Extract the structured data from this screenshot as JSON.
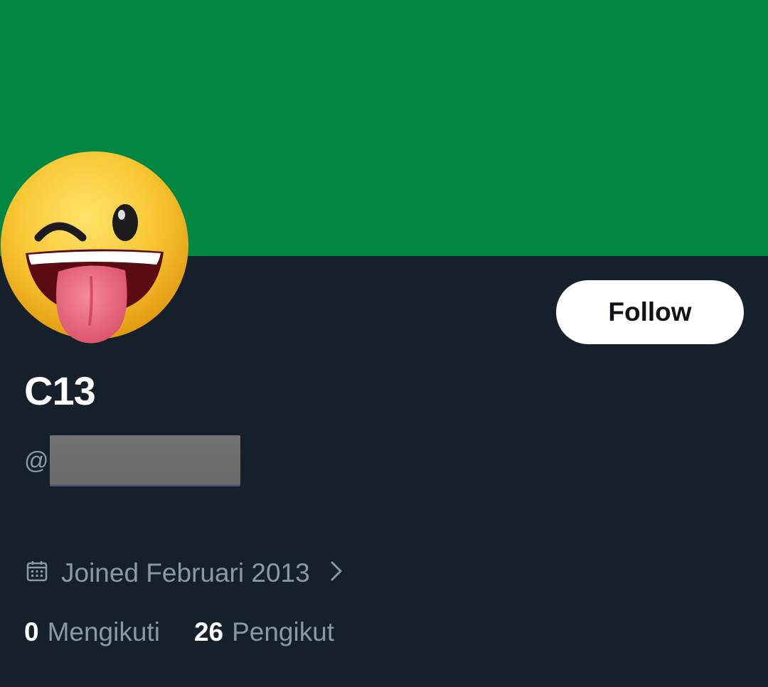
{
  "profile": {
    "display_name": "C13",
    "handle_prefix": "@",
    "follow_label": "Follow",
    "joined": "Joined Februari 2013",
    "following_count": "0",
    "following_label": "Mengikuti",
    "followers_count": "26",
    "followers_label": "Pengikut"
  },
  "icons": {
    "avatar": "winking-tongue-emoji",
    "joined": "calendar-icon",
    "joined_more": "chevron-right-icon"
  },
  "colors": {
    "banner": "#028743",
    "background": "#16202a",
    "primary_text": "#ffffff",
    "secondary_text": "#8b98a5",
    "follow_button_bg": "#ffffff",
    "follow_button_text": "#0f1419"
  }
}
